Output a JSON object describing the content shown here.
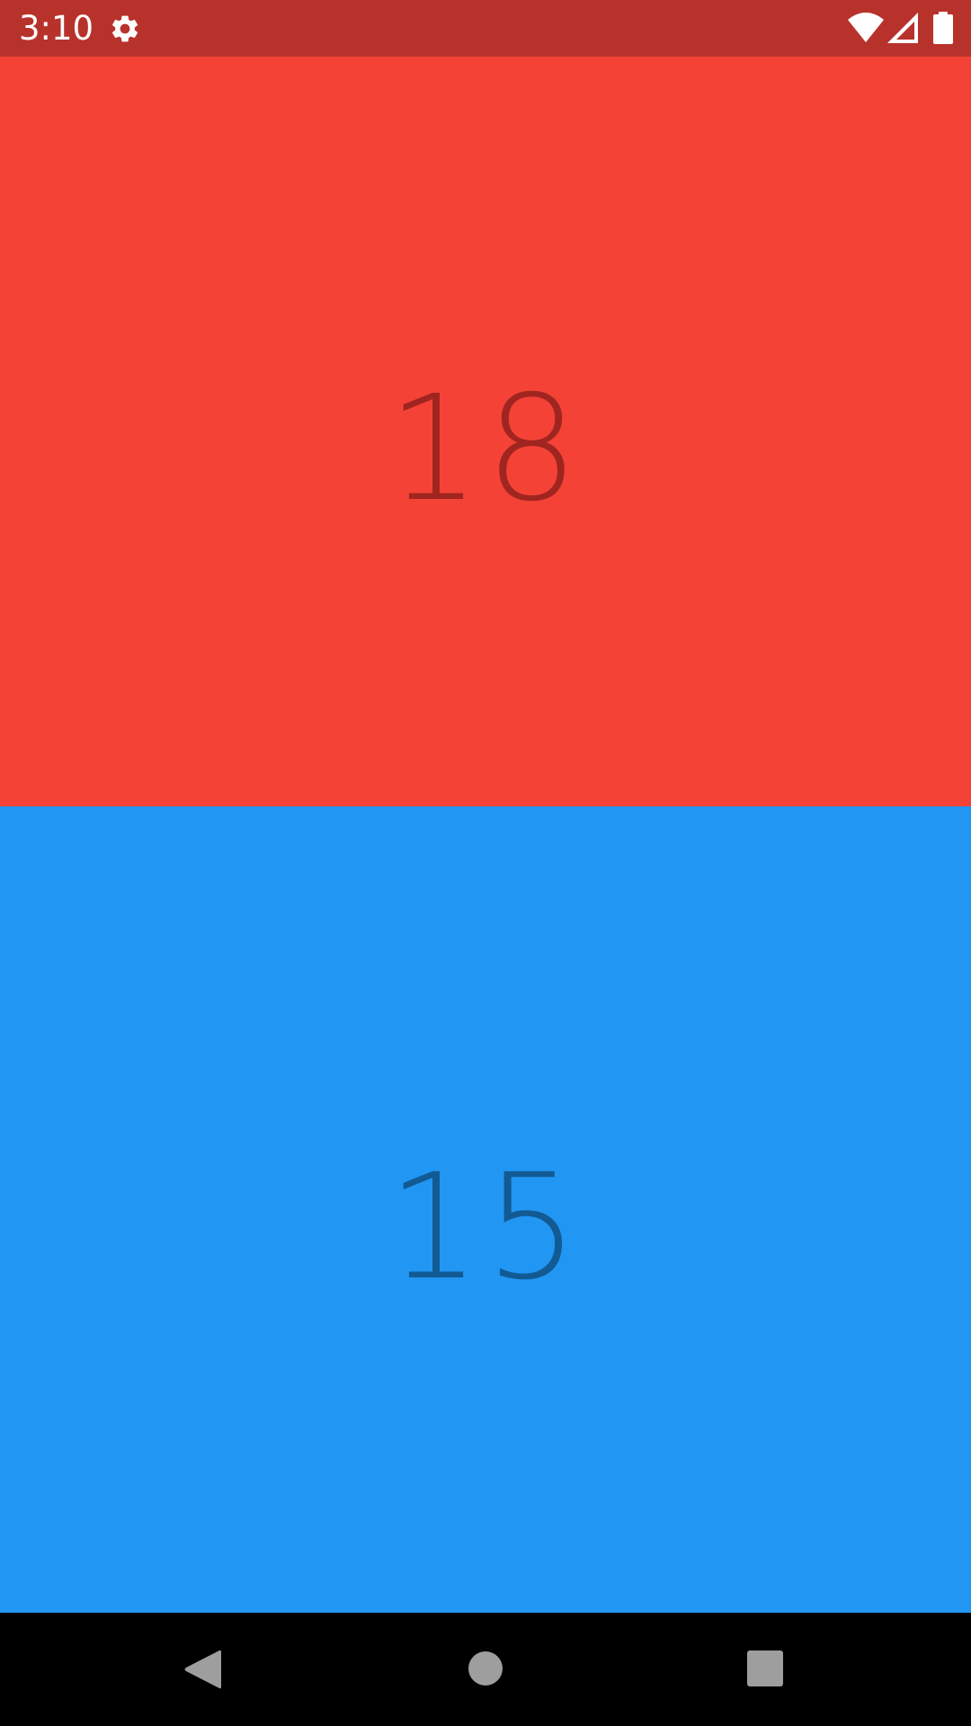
{
  "status_bar": {
    "time": "3:10",
    "background": "#B8322C",
    "icons": [
      "settings-gear-icon",
      "wifi-icon",
      "signal-icon",
      "battery-icon"
    ]
  },
  "players": [
    {
      "score": "18",
      "background": "#F44336",
      "text_color": "#A02520"
    },
    {
      "score": "15",
      "background": "#2196F3",
      "text_color": "#125A93"
    }
  ],
  "nav_bar": {
    "buttons": [
      "back-icon",
      "home-icon",
      "recents-icon"
    ]
  }
}
